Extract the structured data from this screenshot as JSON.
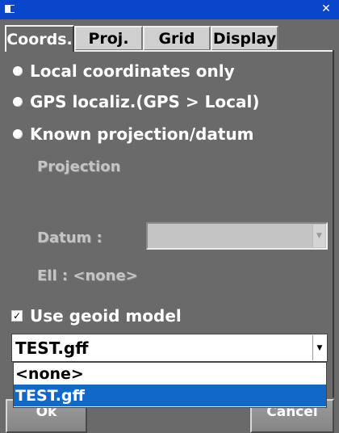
{
  "titlebar": {
    "close_glyph": "✕",
    "icon": "window-icon"
  },
  "tabs": [
    {
      "label": "Coords.",
      "active": true
    },
    {
      "label": "Proj.",
      "active": false
    },
    {
      "label": "Grid",
      "active": false
    },
    {
      "label": "Display",
      "active": false
    }
  ],
  "radios": [
    {
      "label": "Local coordinates only",
      "checked": false
    },
    {
      "label": "GPS localiz.(GPS > Local)",
      "checked": true
    },
    {
      "label": "Known projection/datum",
      "checked": false
    }
  ],
  "projection_label": "Projection",
  "datum": {
    "label": "Datum :",
    "value": ""
  },
  "ellipsoid_label": "Ell : <none>",
  "geoid": {
    "checkbox_label": "Use geoid model",
    "checked": true,
    "selected_value": "TEST.gff",
    "options": [
      "<none>",
      "TEST.gff"
    ],
    "highlighted_option": "TEST.gff"
  },
  "buttons": {
    "ok_label": "Ok",
    "cancel_label": "Cancel"
  },
  "colors": {
    "titlebar": "#0a46cc",
    "panel": "#6a6a6a",
    "selection": "#1268c9"
  }
}
